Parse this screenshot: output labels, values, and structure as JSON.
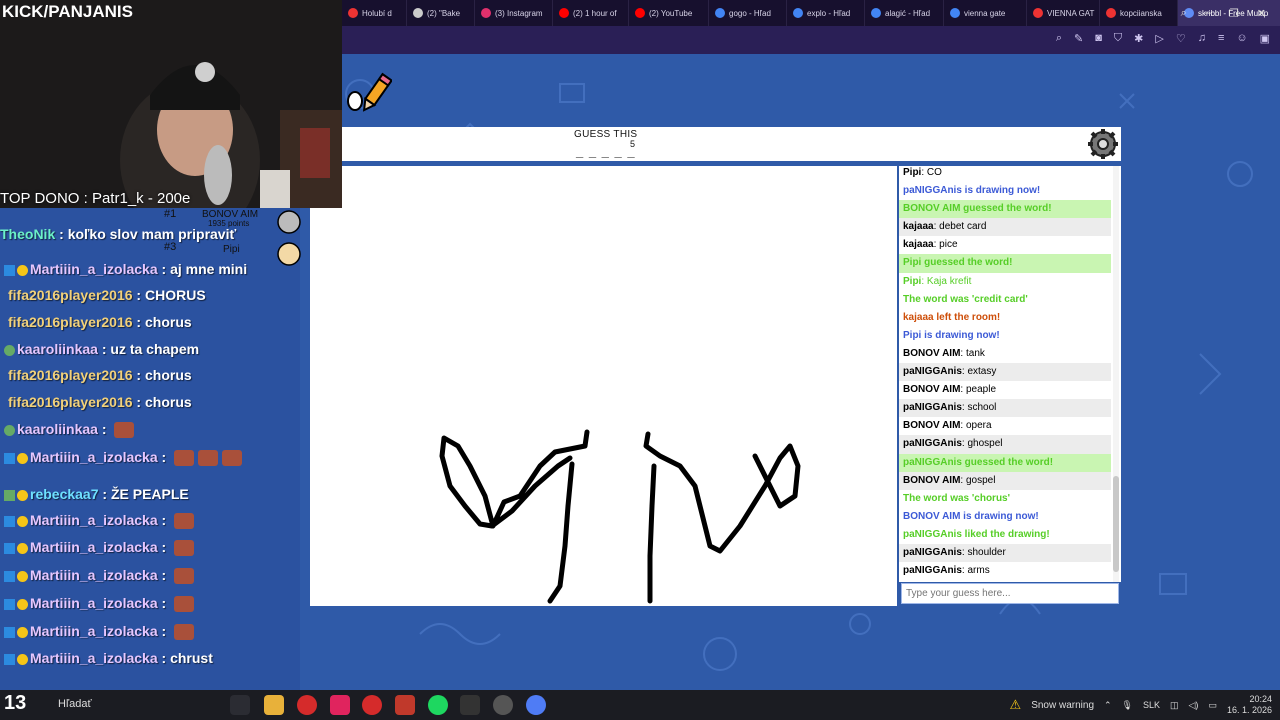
{
  "browser": {
    "tabs": [
      {
        "label": "Holubí d",
        "color": "#e33"
      },
      {
        "label": "(2) \"Bake",
        "color": "#ccc"
      },
      {
        "label": "(3) Instagram",
        "color": "#e1306c"
      },
      {
        "label": "(2) 1 hour of",
        "color": "#f00"
      },
      {
        "label": "(2) YouTube",
        "color": "#f00"
      },
      {
        "label": "gogo - Hľad",
        "color": "#4285f4"
      },
      {
        "label": "explo - Hľad",
        "color": "#4285f4"
      },
      {
        "label": "alagić - Hľad",
        "color": "#4285f4"
      },
      {
        "label": "vienna gate",
        "color": "#4285f4"
      },
      {
        "label": "VIENNA GAT",
        "color": "#e33"
      },
      {
        "label": "kopciianska",
        "color": "#e33"
      },
      {
        "label": "skribbl - Free Multip",
        "color": "#5f8cf5"
      }
    ],
    "new_tab": "+"
  },
  "stream": {
    "channel": "KICK/PANJANIS",
    "top_dono": "TOP DONO : Patr1_k - 200e",
    "chat": [
      {
        "nick": "TheoNik",
        "text": "koľko slov mam pripraviť",
        "nick_color": "#6bf0c8"
      },
      {
        "nick": "Martiiin_a_izolacka",
        "text": "aj mne mini",
        "nick_color": "#e6c7ff"
      },
      {
        "nick": "fifa2016player2016",
        "text": "CHORUS",
        "nick_color": "#f2d17a"
      },
      {
        "nick": "fifa2016player2016",
        "text": "chorus",
        "nick_color": "#f2d17a"
      },
      {
        "nick": "kaaroliinkaa",
        "text": "uz ta chapem",
        "nick_color": "#e6c7ff"
      },
      {
        "nick": "fifa2016player2016",
        "text": "chorus",
        "nick_color": "#f2d17a"
      },
      {
        "nick": "fifa2016player2016",
        "text": "chorus",
        "nick_color": "#f2d17a"
      },
      {
        "nick": "kaaroliinkaa",
        "text": "",
        "nick_color": "#e6c7ff"
      },
      {
        "nick": "Martiiin_a_izolacka",
        "text": "",
        "nick_color": "#e6c7ff"
      },
      {
        "nick": "rebeckaa7",
        "text": "ŽE PEAPLE",
        "nick_color": "#6ee0ff"
      },
      {
        "nick": "Martiiin_a_izolacka",
        "text": "",
        "nick_color": "#e6c7ff"
      },
      {
        "nick": "Martiiin_a_izolacka",
        "text": "",
        "nick_color": "#e6c7ff"
      },
      {
        "nick": "Martiiin_a_izolacka",
        "text": "",
        "nick_color": "#e6c7ff"
      },
      {
        "nick": "Martiiin_a_izolacka",
        "text": "",
        "nick_color": "#e6c7ff"
      },
      {
        "nick": "Martiiin_a_izolacka",
        "text": "",
        "nick_color": "#e6c7ff"
      },
      {
        "nick": "Martiiin_a_izolacka",
        "text": "chrust",
        "nick_color": "#e6c7ff"
      }
    ],
    "ranking": [
      {
        "rank": "#1",
        "name": "BONOV AIM",
        "points": "1935 points"
      },
      {
        "rank": "#3",
        "name": "Pipi",
        "points": ""
      }
    ]
  },
  "game": {
    "guess_label": "GUESS THIS",
    "word_blanks": "_ _ _ _ _",
    "word_length": "5",
    "chat": [
      {
        "author": "Pipi",
        "text": "CO",
        "type": "normal"
      },
      {
        "author": "",
        "text": "paNIGGAnis is drawing now!",
        "type": "sys-blue"
      },
      {
        "author": "",
        "text": "BONOV AIM guessed the word!",
        "type": "sys-green-hl"
      },
      {
        "author": "kajaaa",
        "text": "debet card",
        "type": "normal"
      },
      {
        "author": "kajaaa",
        "text": "pice",
        "type": "normal"
      },
      {
        "author": "",
        "text": "Pipi guessed the word!",
        "type": "sys-green-hl"
      },
      {
        "author": "Pipi",
        "text": "Kaja krefit",
        "type": "green-text"
      },
      {
        "author": "",
        "text": "The word was 'credit card'",
        "type": "sys-green"
      },
      {
        "author": "",
        "text": "kajaaa left the room!",
        "type": "sys-orange"
      },
      {
        "author": "",
        "text": "Pipi is drawing now!",
        "type": "sys-blue"
      },
      {
        "author": "BONOV AIM",
        "text": "tank",
        "type": "normal"
      },
      {
        "author": "paNIGGAnis",
        "text": "extasy",
        "type": "normal"
      },
      {
        "author": "BONOV AIM",
        "text": "peaple",
        "type": "normal"
      },
      {
        "author": "paNIGGAnis",
        "text": "school",
        "type": "normal"
      },
      {
        "author": "BONOV AIM",
        "text": "opera",
        "type": "normal"
      },
      {
        "author": "paNIGGAnis",
        "text": "ghospel",
        "type": "normal"
      },
      {
        "author": "",
        "text": "paNIGGAnis guessed the word!",
        "type": "sys-green-hl"
      },
      {
        "author": "BONOV AIM",
        "text": "gospel",
        "type": "normal"
      },
      {
        "author": "",
        "text": "The word was 'chorus'",
        "type": "sys-green"
      },
      {
        "author": "",
        "text": "BONOV AIM is drawing now!",
        "type": "sys-blue"
      },
      {
        "author": "",
        "text": "paNIGGAnis liked the drawing!",
        "type": "sys-green"
      },
      {
        "author": "paNIGGAnis",
        "text": "shoulder",
        "type": "normal"
      },
      {
        "author": "paNIGGAnis",
        "text": "arms",
        "type": "normal"
      }
    ],
    "chat_placeholder": "Type your guess here..."
  },
  "taskbar": {
    "search_label": "Hľadať",
    "weather_badge": "13",
    "snow_warning": "Snow warning",
    "language": "SLK",
    "time": "20:24",
    "date": "16. 1. 2026"
  }
}
